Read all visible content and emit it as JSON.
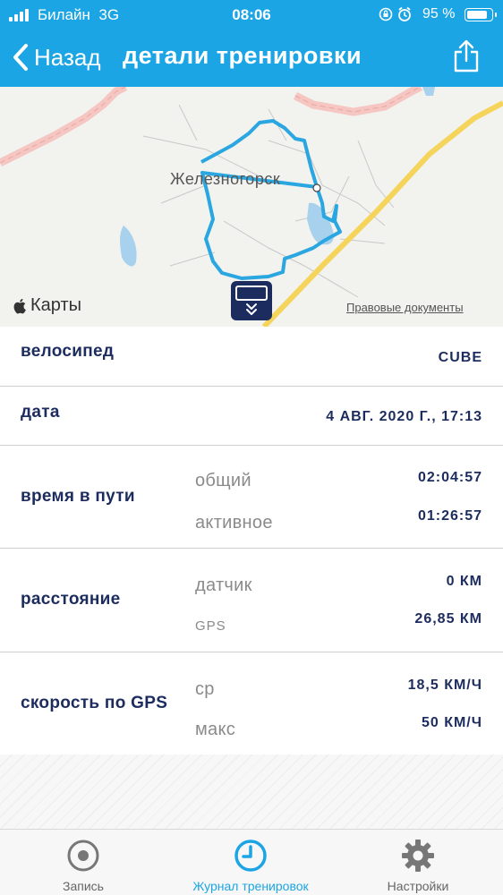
{
  "status_bar": {
    "carrier": "Билайн",
    "network": "3G",
    "time": "08:06",
    "battery": "95 %"
  },
  "nav": {
    "back_label": "Назад",
    "title": "детали тренировки"
  },
  "map": {
    "city_label": "Железногорск",
    "maps_brand": "Карты",
    "legal_link": "Правовые документы"
  },
  "details": {
    "bike_label": "велосипед",
    "bike_value": "CUBE",
    "date_label": "дата",
    "date_value": "4 АВГ. 2020 Г., 17:13",
    "time_label": "время в пути",
    "time_total_label": "общий",
    "time_total_value": "02:04:57",
    "time_active_label": "активное",
    "time_active_value": "01:26:57",
    "distance_label": "расстояние",
    "dist_sensor_label": "датчик",
    "dist_sensor_value": "0 КМ",
    "dist_gps_label": "GPS",
    "dist_gps_value": "26,85 КМ",
    "speed_label": "скорость по GPS",
    "speed_avg_label": "ср",
    "speed_avg_value": "18,5 КМ/Ч",
    "speed_max_label": "макс",
    "speed_max_value": "50 КМ/Ч"
  },
  "tabs": [
    {
      "label": "Запись",
      "icon": "record-icon"
    },
    {
      "label": "Журнал тренировок",
      "icon": "clock-icon"
    },
    {
      "label": "Настройки",
      "icon": "gear-icon"
    }
  ],
  "colors": {
    "header": "#1ca5e4",
    "accent": "#1ca5e4",
    "text_dark": "#1c2c5e",
    "route": "#2aa6e0"
  }
}
